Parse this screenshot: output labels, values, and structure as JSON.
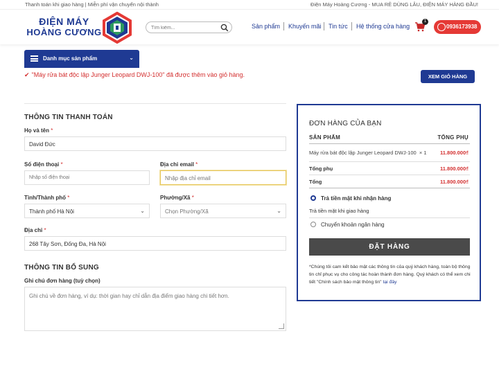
{
  "topbar": {
    "left": "Thanh toán khi giao hàng | Miễn phí vận chuyển nội thành",
    "right": "Điện Máy Hoàng Cương - MUA RẺ DÙNG LÂU, ĐIỆN MÁY HÀNG ĐẦU!"
  },
  "header": {
    "logo_line1": "ĐIỆN MÁY",
    "logo_line2": "HOÀNG CƯƠNG",
    "search_placeholder": "Tìm kiếm...",
    "nav": [
      "Sản phẩm",
      "Khuyến mãi",
      "Tin tức",
      "Hệ thống cửa hàng"
    ],
    "cart_count": "1",
    "phone": "0936173938"
  },
  "category_button": "Danh mục sản phẩm",
  "notice": "\"Máy rửa bát độc lập Junger Leopard DWJ-100\" đã được thêm vào giỏ hàng.",
  "view_cart_button": "XEM GIỎ HÀNG",
  "billing": {
    "title": "THÔNG TIN THANH TOÁN",
    "name_label": "Họ và tên",
    "name_value": "David Đức",
    "phone_label": "Số điện thoại",
    "phone_placeholder": "Nhập số điện thoại",
    "email_label": "Địa chỉ email",
    "email_placeholder": "Nhập địa chỉ email",
    "city_label": "Tỉnh/Thành phố",
    "city_value": "Thành phố Hà Nội",
    "ward_label": "Phường/Xã",
    "ward_placeholder": "Chọn Phường/Xã",
    "address_label": "Địa chỉ",
    "address_value": "268 Tây Sơn, Đống Đa, Hà Nội",
    "required_mark": "*"
  },
  "additional": {
    "title": "THÔNG TIN BỔ SUNG",
    "notes_label": "Ghi chú đơn hàng (tuỳ chọn)",
    "notes_placeholder": "Ghi chú về đơn hàng, ví dụ: thời gian hay chỉ dẫn địa điểm giao hàng chi tiết hơn."
  },
  "order": {
    "title": "ĐƠN HÀNG CỦA BẠN",
    "col_product": "SẢN PHẨM",
    "col_total": "TỔNG PHỤ",
    "item_name": "Máy rửa bát độc lập Junger Leopard DWJ-100",
    "item_qty": "× 1",
    "item_price": "11.800.000₫",
    "subtotal_label": "Tổng phụ",
    "subtotal_value": "11.800.000₫",
    "total_label": "Tổng",
    "total_value": "11.800.000₫",
    "pay_cod": "Trả tiền mặt khi nhận hàng",
    "pay_cod_note": "Trả tiền mặt khi giao hàng",
    "pay_bank": "Chuyển khoản ngân hàng",
    "place_order": "ĐẶT HÀNG",
    "privacy_text": "*Chúng tôi cam kết bảo mật các thông tin của quý khách hàng, toàn bộ thông tin chỉ phục vụ cho công tác hoàn thành đơn hàng. Quý khách có thể xem chi tiết \"Chính sách bảo mật thông tin\"",
    "privacy_link": "tại đây"
  },
  "colors": {
    "brand_blue": "#1f3a93",
    "accent_red": "#d32f2f",
    "order_button": "#4a4a4a"
  }
}
